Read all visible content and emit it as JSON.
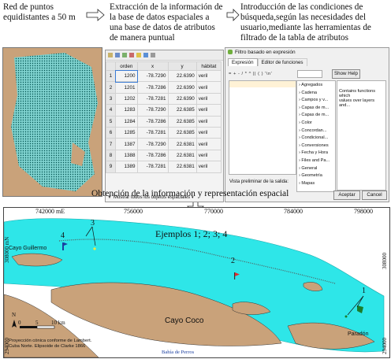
{
  "captions": {
    "step1": [
      "Red de puntos",
      "equidistantes a 50 m"
    ],
    "step2": [
      "Extracción de la información de",
      "la base de datos espaciales a",
      "una base de datos de atributos",
      "de manera puntual"
    ],
    "step3": [
      "Introducción de las condiciones de",
      "búsqueda,según las necesidades del",
      "usuario,mediante las herramientas de",
      "filtrado de la tabla de atributos"
    ],
    "step4": "Obtención de la información y representación espacial"
  },
  "attribute_table": {
    "columns": [
      "orden",
      "x",
      "y",
      "hábitat"
    ],
    "rows": [
      {
        "n": "1",
        "orden": "1200",
        "x": "-78.7290",
        "y": "22.6390",
        "habitat": "veril"
      },
      {
        "n": "2",
        "orden": "1201",
        "x": "-78.7286",
        "y": "22.6390",
        "habitat": "veril"
      },
      {
        "n": "3",
        "orden": "1202",
        "x": "-78.7281",
        "y": "22.6390",
        "habitat": "veril"
      },
      {
        "n": "4",
        "orden": "1283",
        "x": "-78.7290",
        "y": "22.6385",
        "habitat": "veril"
      },
      {
        "n": "5",
        "orden": "1284",
        "x": "-78.7286",
        "y": "22.6385",
        "habitat": "veril"
      },
      {
        "n": "6",
        "orden": "1285",
        "x": "-78.7281",
        "y": "22.6385",
        "habitat": "veril"
      },
      {
        "n": "7",
        "orden": "1387",
        "x": "-78.7290",
        "y": "22.6381",
        "habitat": "veril"
      },
      {
        "n": "8",
        "orden": "1388",
        "x": "-78.7286",
        "y": "22.6381",
        "habitat": "veril"
      },
      {
        "n": "9",
        "orden": "1389",
        "x": "-78.7281",
        "y": "22.6381",
        "habitat": "veril"
      }
    ],
    "footer": "Mostrar todos los objetos espaciales"
  },
  "filter_dialog": {
    "title": "Filtro basado en expresión",
    "tabs": [
      "Expresión",
      "Editor de funciones"
    ],
    "show_help": "Show Help",
    "operators": "= + - / * ^ || ( ) '\\n'",
    "functions": [
      "Agregados",
      "Cadena",
      "Campos y v...",
      "Capas de m...",
      "Capas de m...",
      "Color",
      "Concordan...",
      "Condicional...",
      "Conversiones",
      "Fecha y Hora",
      "Files and Pa...",
      "General",
      "Geometría",
      "Mapas"
    ],
    "help_text": [
      "Contains functions which",
      "values over layers and..."
    ],
    "preview_label": "Vista preliminar de la salida:",
    "ok_label": "Aceptar",
    "cancel_label": "Cancel"
  },
  "map": {
    "top_ticks": [
      "742000 mE",
      "756000",
      "770000",
      "784000",
      "798000"
    ],
    "left_ticks": [
      "308000 mN",
      "294000"
    ],
    "right_ticks": [
      "308000",
      "294000"
    ],
    "example_label": "Ejemplos 1; 2; 3; 4",
    "markers": [
      "1",
      "2",
      "3",
      "4"
    ],
    "places": [
      "Cayo Coco",
      "Cayo Guillermo",
      "Paradón",
      "Bahía de Perros"
    ],
    "scale": [
      "0",
      "5",
      "10 km"
    ],
    "projection": [
      "Proyección cónica conforme de Lambert.",
      "Cuba Norte. Elipsoide de Clarke 1866"
    ],
    "north": "N"
  }
}
